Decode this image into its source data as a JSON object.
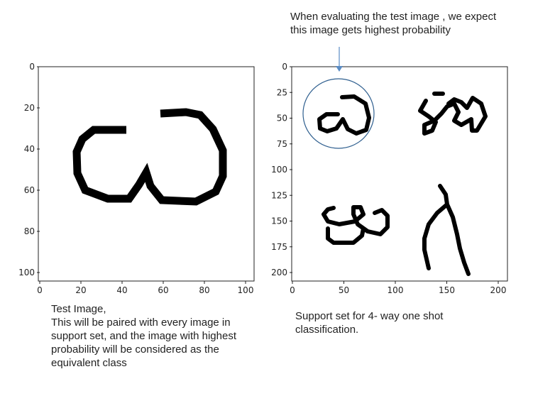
{
  "annotation": {
    "top": "When evaluating the test image , we expect\nthis image gets highest probability"
  },
  "captions": {
    "left": "Test Image,\nThis will be paired with every image in\nsupport set, and the image with highest\nprobability will be considered as the\nequivalent class",
    "right": "Support set for 4- way one shot\nclassification."
  },
  "plots": {
    "left": {
      "x_ticks": [
        "0",
        "20",
        "40",
        "60",
        "80",
        "100"
      ],
      "y_ticks": [
        "0",
        "20",
        "40",
        "60",
        "80",
        "100"
      ]
    },
    "right": {
      "x_ticks": [
        "0",
        "50",
        "100",
        "150",
        "200"
      ],
      "y_ticks": [
        "0",
        "25",
        "50",
        "75",
        "100",
        "125",
        "150",
        "175",
        "200"
      ]
    }
  },
  "colors": {
    "frame": "#222222",
    "glyph": "#000000",
    "highlight_circle": "#2f5f8f",
    "arrow": "#5b8cc4"
  }
}
